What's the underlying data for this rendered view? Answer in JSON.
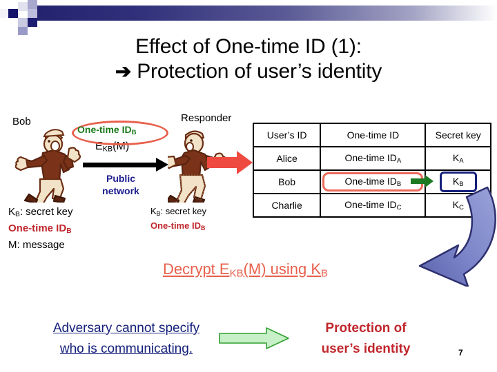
{
  "slide": {
    "page_number": "7",
    "title_line1": "Effect of One-time ID (1):",
    "title_arrow": "➔",
    "title_line2": "Protection of user’s identity"
  },
  "colors": {
    "header_gradient_dark": "#22226e",
    "header_square_navy": "#14146b",
    "green_text": "#1a7a1a",
    "red_ellipse": "#e8604c",
    "red_text": "#c0272d",
    "navy_text": "#14207a",
    "public_network_blue": "#1b1b8f",
    "red_block_arrow": "#ef4a40",
    "green_block_arrow_fill": "#c8f0c8",
    "green_block_arrow_stroke": "#2fa02f",
    "table_highlight_red": "#ea6a5a",
    "table_highlight_navy": "#14207a",
    "green_small_arrow": "#1d7a23",
    "curved_arrow_blue": "#7b84c8"
  },
  "scene": {
    "sender_label": "Bob",
    "receiver_label": "Responder",
    "onetime_id_bubble": "One-time ID",
    "onetime_id_bubble_sub": "B",
    "encrypted_msg": "E",
    "encrypted_msg_sub": "KB",
    "encrypted_msg_tail": "(M)",
    "network_label_line1": "Public",
    "network_label_line2": "network"
  },
  "legend_left": {
    "line1_main": "K",
    "line1_sub": "B",
    "line1_rest": ": secret key",
    "line2_main": "One-time ID",
    "line2_sub": "B",
    "line3": "M: message"
  },
  "legend_right": {
    "line1_main": "K",
    "line1_sub": "B",
    "line1_rest": ": secret key",
    "line2_main": "One-time ID",
    "line2_sub": "B"
  },
  "table": {
    "headers": [
      "User’s ID",
      "One-time ID",
      "Secret key"
    ],
    "rows": [
      {
        "user": "Alice",
        "otid": "One-time ID",
        "otid_sub": "A",
        "key": "K",
        "key_sub": "A"
      },
      {
        "user": "Bob",
        "otid": "One-time ID",
        "otid_sub": "B",
        "key": "K",
        "key_sub": "B"
      },
      {
        "user": "Charlie",
        "otid": "One-time ID",
        "otid_sub": "C",
        "key": "K",
        "key_sub": "C"
      }
    ]
  },
  "decrypt": {
    "prefix": "Decrypt E",
    "sub1": "KB",
    "mid": "(M) using K",
    "sub2": "B"
  },
  "bottom": {
    "adversary_line1": "Adversary cannot specify",
    "adversary_line2": "who is communicating.",
    "result_line1": "Protection of",
    "result_line2": "user’s identity"
  }
}
